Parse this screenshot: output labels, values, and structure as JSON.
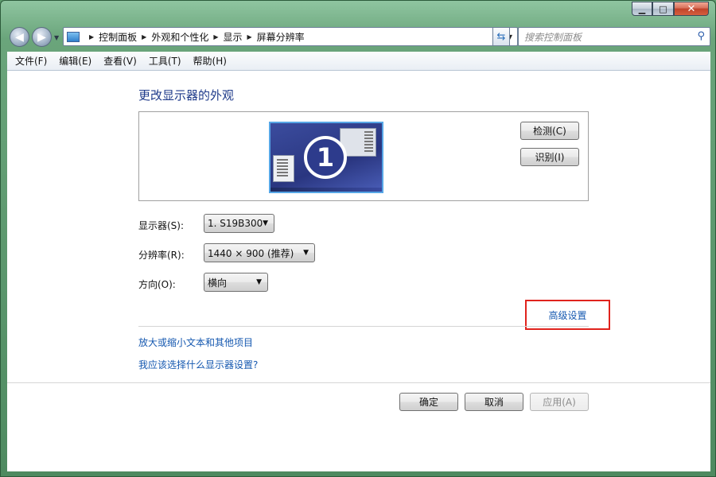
{
  "window": {
    "caption_buttons": {
      "minimize": "▁",
      "maximize": "□",
      "close": "✕"
    }
  },
  "nav": {
    "back": "◀",
    "forward": "▶",
    "breadcrumb": [
      "控制面板",
      "外观和个性化",
      "显示",
      "屏幕分辨率"
    ],
    "search_placeholder": "搜索控制面板"
  },
  "menu": [
    "文件(F)",
    "编辑(E)",
    "查看(V)",
    "工具(T)",
    "帮助(H)"
  ],
  "main": {
    "heading": "更改显示器的外观",
    "monitor_number": "1",
    "detect_button": "检测(C)",
    "identify_button": "识别(I)",
    "display_label": "显示器(S):",
    "display_value": "1. S19B300",
    "resolution_label": "分辨率(R):",
    "resolution_value": "1440 × 900 (推荐)",
    "orientation_label": "方向(O):",
    "orientation_value": "横向",
    "advanced_link": "高级设置",
    "link_text_size": "放大或缩小文本和其他项目",
    "link_which_settings": "我应该选择什么显示器设置?",
    "ok_button": "确定",
    "cancel_button": "取消",
    "apply_button": "应用(A)"
  },
  "colors": {
    "link": "#1558b0",
    "heading": "#1e3a8a",
    "highlight_border": "#e0231d"
  }
}
